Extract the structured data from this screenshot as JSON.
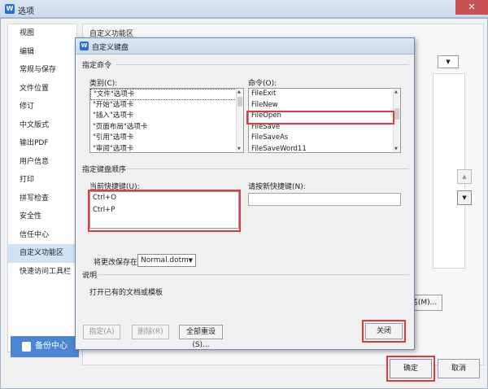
{
  "window": {
    "title": "选项"
  },
  "sidebar": {
    "items": [
      {
        "label": "视图"
      },
      {
        "label": "编辑"
      },
      {
        "label": "常规与保存"
      },
      {
        "label": "文件位置"
      },
      {
        "label": "修订"
      },
      {
        "label": "中文版式"
      },
      {
        "label": "输出PDF"
      },
      {
        "label": "用户信息"
      },
      {
        "label": "打印"
      },
      {
        "label": "拼写检查"
      },
      {
        "label": "安全性"
      },
      {
        "label": "信任中心"
      },
      {
        "label": "自定义功能区"
      },
      {
        "label": "快速访问工具栏"
      }
    ],
    "backup_label": "备份中心"
  },
  "right_panel": {
    "title": "自定义功能区",
    "rename_label": "名(M)..."
  },
  "footer": {
    "ok_label": "确定",
    "cancel_label": "取消"
  },
  "dialog": {
    "title": "自定义键盘",
    "specify_command_label": "指定命令",
    "category_label": "类别(C):",
    "categories": [
      "\"文件\"选项卡",
      "\"开始\"选项卡",
      "\"插入\"选项卡",
      "\"页面布局\"选项卡",
      "\"引用\"选项卡",
      "\"审阅\"选项卡"
    ],
    "command_label": "命令(O):",
    "commands": [
      "FileExit",
      "FileNew",
      "FileOpen",
      "FileSave",
      "FileSaveAs",
      "FileSaveWord11"
    ],
    "selected_command": "FileOpen",
    "key_sequence_label": "指定键盘顺序",
    "current_keys_label": "当前快捷键(U):",
    "current_keys": [
      "Ctrl+O",
      "Ctrl+P"
    ],
    "new_key_label": "请按新快捷键(N):",
    "new_key_value": "",
    "save_in_label": "将更改保存在(V):",
    "save_in_value": "Normal.dotm",
    "description_label": "说明",
    "description_text": "打开已有的文档或模板",
    "assign_label": "指定(A)",
    "remove_label": "删除(R)",
    "reset_all_label": "全部重设(S)...",
    "close_label": "关闭"
  },
  "icons": {
    "app": "wps-writer-icon",
    "backup": "backup-icon",
    "close": "close-icon"
  },
  "colors": {
    "highlight_border": "#e03a3a",
    "sidebar_active": "#cfe3f7",
    "backup_bg": "#4a86d4"
  }
}
